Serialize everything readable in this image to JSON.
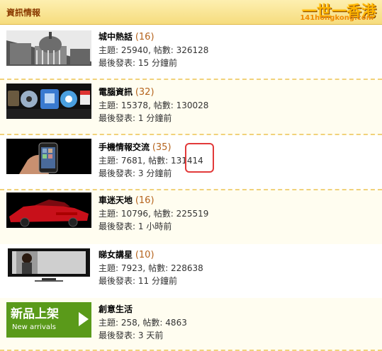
{
  "header": {
    "title": "資訊情報"
  },
  "logo": {
    "main": "一世一香港",
    "sub": "141hongkong.com"
  },
  "forums": [
    {
      "name": "城中熱話",
      "count": "(16)",
      "topics_label": "主題:",
      "topics": "25940",
      "posts_label": "帖數:",
      "posts": "326128",
      "last_label": "最後發表:",
      "last": "15 分鐘前",
      "thumb": "building-photo"
    },
    {
      "name": "電腦資訊",
      "count": "(32)",
      "topics_label": "主題:",
      "topics": "15378",
      "posts_label": "帖數:",
      "posts": "130028",
      "last_label": "最後發表:",
      "last": "1 分鐘前",
      "thumb": "mac-dock-icons"
    },
    {
      "name": "手機情報交流",
      "count": "(35)",
      "topics_label": "主題:",
      "topics": "7681",
      "posts_label": "帖數:",
      "posts": "131414",
      "last_label": "最後發表:",
      "last": "3 分鐘前",
      "thumb": "phone-photo"
    },
    {
      "name": "車迷天地",
      "count": "(16)",
      "topics_label": "主題:",
      "topics": "10796",
      "posts_label": "帖數:",
      "posts": "225519",
      "last_label": "最後發表:",
      "last": "1 小時前",
      "thumb": "red-car-photo"
    },
    {
      "name": "睇女講星",
      "count": "(10)",
      "topics_label": "主題:",
      "topics": "7923",
      "posts_label": "帖數:",
      "posts": "228638",
      "last_label": "最後發表:",
      "last": "11 分鐘前",
      "thumb": "tv-photo"
    },
    {
      "name": "創意生活",
      "count": "",
      "topics_label": "主題:",
      "topics": "258",
      "posts_label": "帖數:",
      "posts": "4863",
      "last_label": "最後發表:",
      "last": "3 天前",
      "thumb": "new-arrivals-banner"
    }
  ],
  "banner": {
    "line1": "新品上架",
    "line2": "New arrivals"
  },
  "colors": {
    "header_text": "#8a3a00",
    "count": "#b5631c",
    "highlight": "#e23a3a",
    "banner_green": "#5a9a1a"
  }
}
